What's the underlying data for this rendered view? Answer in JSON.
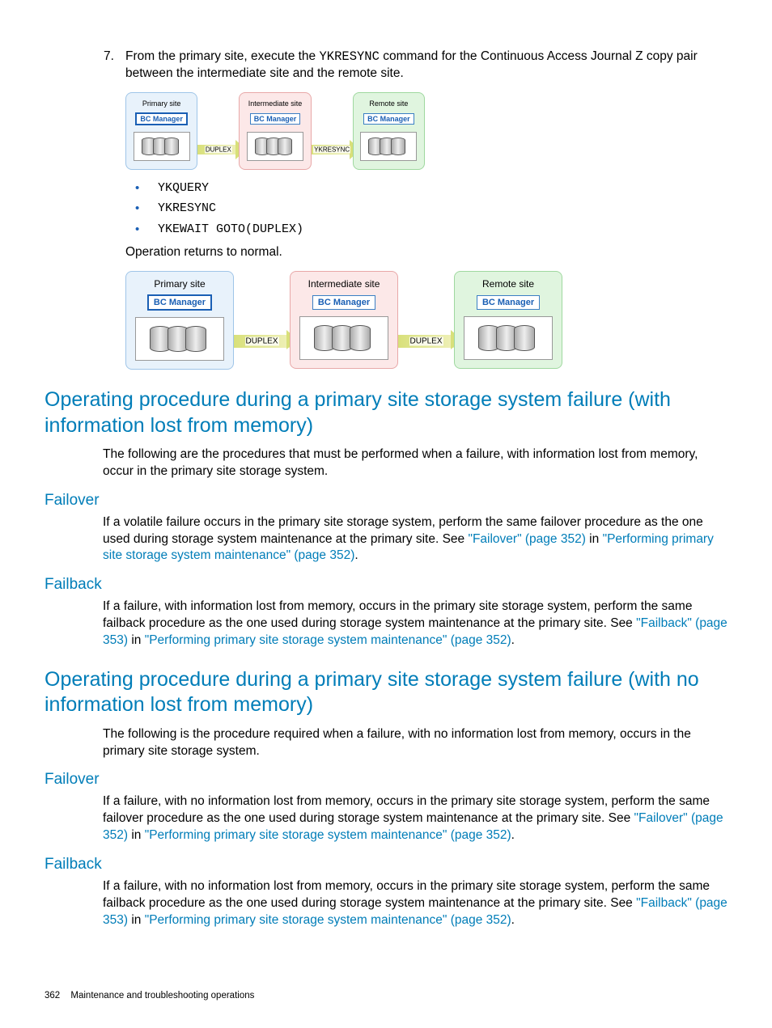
{
  "step": {
    "num": "7.",
    "text_a": "From the primary site, execute the ",
    "cmd": "YKRESYNC",
    "text_b": " command for the Continuous Access Journal Z copy pair between the intermediate site and the remote site."
  },
  "diag1": {
    "primary": "Primary site",
    "intermediate": "Intermediate site",
    "remote": "Remote site",
    "bc": "BC Manager",
    "duplex": "DUPLEX",
    "ykresync": "YKRESYNC"
  },
  "cmds": {
    "a": "YKQUERY",
    "b": "YKRESYNC",
    "c": "YKEWAIT GOTO(DUPLEX)"
  },
  "op_returns": "Operation returns to normal.",
  "diag2": {
    "primary": "Primary site",
    "intermediate": "Intermediate site",
    "remote": "Remote site",
    "bc": "BC Manager",
    "duplex": "DUPLEX"
  },
  "h2a": "Operating procedure during a primary site storage system failure (with information lost from memory)",
  "p1": "The following are the procedures that must be performed when a failure, with information lost from memory, occur in the primary site storage system.",
  "h3_failover": "Failover",
  "p2a": "If a volatile failure occurs in the primary site storage system, perform the same failover procedure as the one used during storage system maintenance at the primary site. See ",
  "link_failover352": "\"Failover\" (page 352)",
  "in_word": " in ",
  "link_maint352": "\"Performing primary site storage system maintenance\" (page 352)",
  "period": ".",
  "h3_failback": "Failback",
  "p3a": "If a failure, with information lost from memory, occurs in the primary site storage system, perform the same failback procedure as the one used during storage system maintenance at the primary site. See ",
  "link_failback353": "\"Failback\" (page 353)",
  "h2b": "Operating procedure during a primary site storage system failure (with no information lost from memory)",
  "p4": "The following is the procedure required when a failure, with no information lost from memory, occurs in the primary site storage system.",
  "p5a": "If a failure, with no information lost from memory, occurs in the primary site storage system, perform the same failover procedure as the one used during storage system maintenance at the primary site. See ",
  "p6a": "If a failure, with no information lost from memory, occurs in the primary site storage system, perform the same failback procedure as the one used during storage system maintenance at the primary site. See ",
  "footer": {
    "page": "362",
    "chapter": "Maintenance and troubleshooting operations"
  }
}
